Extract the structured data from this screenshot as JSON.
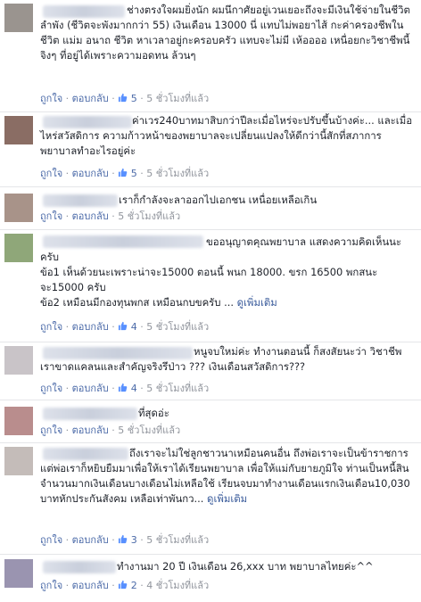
{
  "actions": {
    "like": "ถูกใจ",
    "reply": "ตอบกลับ",
    "dot": "·",
    "more": "ดูเพิ่มเติม"
  },
  "comments": [
    {
      "text": "ช่างตรงใจผมยิ่งนัก ผมนึกาศัยอยู่เวนเยอะถึงจะมีเงินใช้จ่ายในชีวิต ลำพัง (ชีวิตจะพังมากกว่า 55) เงินเดือน 13000 นี่ แทบไม่พอยาไส้ กะค่าครองชีพในชีวิต แม่ม อนาถ ชีวิต หาเวลาอยู่กะครอบครัว แทบจะไม่มี เห้ออออ เหนื่อยกะวิชาชีพนี้จิงๆ ที่อยู่ได้เพราะความอดทน ล้วนๆ",
      "likes": "5",
      "time": "5 ชั่วโมงที่แล้ว"
    },
    {
      "text": "ค่าเวร240บาทมาสิบกว่าปีละเมื่อไหร่จะปรับขึ้นบ้างค่ะ... และเมื่อไหร่สวัสดิการ ความก้าวหน้าของพยาบาลจะเปลี่ยนแปลงให้ดีกว่านี้สักที่สภาการพยาบาลทำอะไรอยู่ค่ะ",
      "likes": "5",
      "time": "5 ชั่วโมงที่แล้ว"
    },
    {
      "text": "เราก็กำลังจะลาออกไปเอกชน เหนื่อยเหลือเกิน",
      "likes": "",
      "time": "5 ชั่วโมงที่แล้ว"
    },
    {
      "text": "ขออนุญาตคุณพยาบาล แสดงความคิดเห็นนะครับ\nข้อ1 เห็นด้วยนะเพราะน่าจะ15000 ตอนนี้ พนก 18000. ขรก 16500 พกสนะจะ15000 ครับ\nข้อ2 เหมือนมีกองทุนพกส เหมือนกบขครับ ... ",
      "likes": "4",
      "time": "5 ชั่วโมงที่แล้ว"
    },
    {
      "text": "หนูจบใหม่ค่ะ ทำงานตอนนี้ ก็สงสัยนะว่า วิชาชีพเราขาดแคลนและสำคัญจริงรึป่าว ??? เงินเดือนสวัสดิการ???",
      "likes": "4",
      "time": "5 ชั่วโมงที่แล้ว"
    },
    {
      "text": "ที่สุดอ่ะ",
      "likes": "",
      "time": "5 ชั่วโมงที่แล้ว"
    },
    {
      "text": "ถึงเราจะไม่ใช่ลูกชาวนาเหมือนคนอื่น ถึงพ่อเราจะเป็นข้าราชการ แต่พ่อเราก็หยิบยืมมาเพื่อให้เราได้เรียนพยาบาล เพื่อให้แม่กับยายภูมิใจ ท่านเป็นหนี้สินจำนวนมากเงินเดือนบางเดือนไม่เหลือใช้ เรียนจบมาทำงานเดือนแรกเงินเดือน10,030 บาทหักประกันสังคม เหลือเท่าพันกว... ",
      "likes": "3",
      "time": "5 ชั่วโมงที่แล้ว"
    },
    {
      "text": "ทำงานมา 20 ปี เงินเดือน 26,xxx บาท พยาบาลไทยค่ะ^^",
      "likes": "2",
      "time": "4 ชั่วโมงที่แล้ว"
    }
  ]
}
